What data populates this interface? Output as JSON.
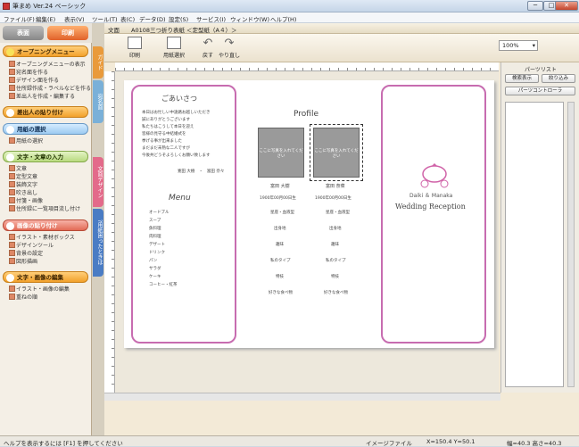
{
  "window": {
    "title": "筆まめ Ver.24 ベーシック",
    "minimize": "─",
    "maximize": "□",
    "close": "✕"
  },
  "menu": [
    "ファイル(F)",
    "編集(E)",
    "表示(V)",
    "ツール(T)",
    "表(C)",
    "データ(D)",
    "設定(S)",
    "サービス(I)",
    "ウィンドウ(W)",
    "ヘルプ(H)"
  ],
  "left": {
    "tab_omote": "表面",
    "tab_print": "印刷",
    "sections": [
      {
        "label": "オープニングメニュー",
        "items": [
          "オープニングメニューの表示",
          "宛名面を作る",
          "デザイン面を作る",
          "住所録作成・ラベルなどを作る",
          "差出人を作成・編集する"
        ]
      },
      {
        "label": "差出人の貼り付け",
        "items": []
      },
      {
        "label": "用紙の選択",
        "items": [
          "用紙の選択"
        ]
      },
      {
        "label": "文字・文章の入力",
        "items": [
          "文章",
          "定型文章",
          "装飾文字",
          "吹き出し",
          "付箋・画像",
          "住所録に一覧項目流し付け"
        ]
      },
      {
        "label": "画像の貼り付け",
        "items": [
          "イラスト・素材ボックス",
          "デザインツール",
          "背景の設定",
          "図形描画"
        ]
      },
      {
        "label": "文字・画像の編集",
        "items": [
          "イラスト・画像の編集",
          "重ねの順"
        ]
      }
    ]
  },
  "sidetabs": [
    "ガイド",
    "宛名面",
    "文面デザイン",
    "?用紙困ったときは"
  ],
  "doc": {
    "tab_label": "文面",
    "doc_title": "A0108三つ折り表紙 ＜定型紙（A４）＞",
    "tools": [
      "印刷",
      "用紙選択",
      "戻す",
      "やり直し"
    ],
    "zoom": "100%"
  },
  "paper": {
    "greeting_title": "ごあいさつ",
    "greeting_lines": [
      "本日はお忙しい中遠路お越しいただき",
      "誠にありがとうございます",
      "私たちはこうして本日を迎え",
      "皆様の見守る中結婚式を",
      "挙げる事が出来ました",
      "まだまだ未熟な二人ですが",
      "今後共どうぞよろしくお願い致します"
    ],
    "greeting_sign": "寛田 大樹　・　富田 奈々",
    "menu_title": "Menu",
    "menu_items": [
      "オードブル",
      "スープ",
      "魚料理",
      "肉料理",
      "デザート",
      "ドリンク",
      "パン",
      "サラダ",
      "ケーキ",
      "コーヒー・紅茶"
    ],
    "profile_title": "Profile",
    "photo_label_1": "ここに写真を入れてください",
    "photo_label_2": "ここに写真を入れてください",
    "groom_name": "富田 大樹",
    "bride_name": "富田 奈菜",
    "groom_birth": "1900年00月00日生",
    "bride_birth": "1900年00月00日生",
    "profile_rows": [
      "星座・血液型",
      "出身地",
      "趣味",
      "私のタイプ",
      "特技",
      "好きな食べ物"
    ],
    "cover_names": "Daiki ＆ Manaka",
    "cover_title": "Wedding Reception"
  },
  "right": {
    "label": "パーツリスト",
    "btn_search": "検索表示",
    "btn_filter": "絞り込み",
    "btn_controller": "パーツコントローラ"
  },
  "status": {
    "help": "ヘルプを表示するには [F1] を押してください",
    "file": "イメージファイル",
    "coords": "X=150.4 Y=50.1",
    "size": "幅=40.3 高さ=40.3"
  },
  "colors": {
    "accent_pink": "#d063a8",
    "left_bg": "#f4efe6",
    "orange_head": "#f2a12b"
  }
}
